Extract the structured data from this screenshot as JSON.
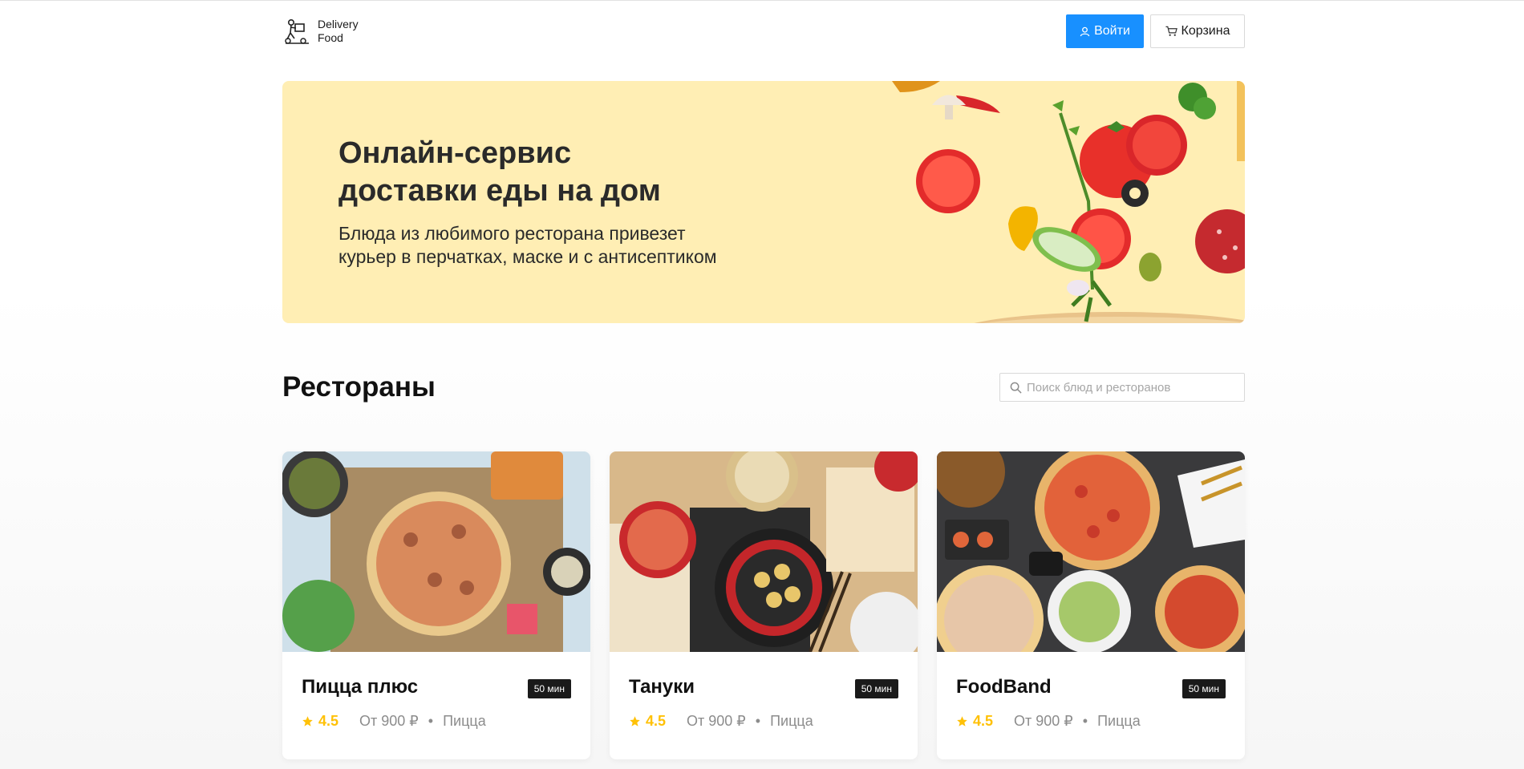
{
  "header": {
    "logo_line1": "Delivery",
    "logo_line2": "Food",
    "login_label": "Войти",
    "cart_label": "Корзина"
  },
  "promo": {
    "title": "Онлайн-сервис\nдоставки еды на дом",
    "text": "Блюда из любимого ресторана привезет\nкурьер в перчатках, маске и с антисептиком"
  },
  "section": {
    "title": "Рестораны",
    "search_placeholder": "Поиск блюд и ресторанов"
  },
  "restaurants": [
    {
      "name": "Пицца плюс",
      "time": "50 мин",
      "rating": "4.5",
      "price": "От 900 ₽",
      "category": "Пицца"
    },
    {
      "name": "Тануки",
      "time": "50 мин",
      "rating": "4.5",
      "price": "От 900 ₽",
      "category": "Пицца"
    },
    {
      "name": "FoodBand",
      "time": "50 мин",
      "rating": "4.5",
      "price": "От 900 ₽",
      "category": "Пицца"
    }
  ],
  "colors": {
    "accent": "#1890ff",
    "promo_bg": "#ffeeb4",
    "rating": "#ffc107",
    "badge_bg": "#1a1a1a"
  },
  "icons": {
    "login": "user-icon",
    "cart": "shopping-cart-icon",
    "search": "search-icon",
    "rating": "star-icon"
  }
}
